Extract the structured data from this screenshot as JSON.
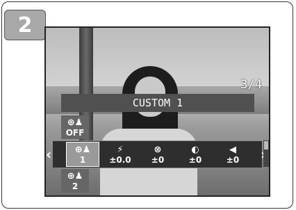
{
  "step_number": "2",
  "screen": {
    "frame_counter": "3/4",
    "mode_title": "CUSTOM 1",
    "side_items": [
      {
        "symbol": "⊕♟",
        "value": "OFF"
      },
      {
        "symbol": "⊕♟",
        "value": "2"
      }
    ],
    "row_items": [
      {
        "symbol": "⊕♟",
        "value": "1",
        "icon": "subject-tracking-icon",
        "selected": true
      },
      {
        "symbol": "⚡",
        "value": "±0.0",
        "icon": "flash-compensation-icon"
      },
      {
        "symbol": "⊗",
        "value": "±0",
        "icon": "saturation-icon"
      },
      {
        "symbol": "◐",
        "value": "±0",
        "icon": "contrast-icon"
      },
      {
        "symbol": "◀",
        "value": "±0",
        "icon": "sharpness-icon"
      }
    ],
    "left_arrow": "‹",
    "right_arrow": "›"
  }
}
